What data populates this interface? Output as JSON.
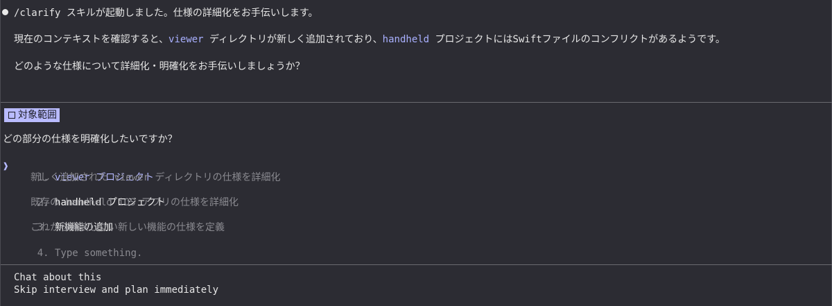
{
  "message": {
    "intro": "/clarify スキルが起動しました。仕様の詳細化をお手伝いします。",
    "context_pre": "現在のコンテキストを確認すると、",
    "context_viewer": "viewer",
    "context_mid": " ディレクトリが新しく追加されており、",
    "context_handheld": "handheld",
    "context_post": " プロジェクトにはSwiftファイルのコンフリクトがあるようです。",
    "question": "どのような仕様について詳細化・明確化をお手伝いしましょうか？"
  },
  "prompt": {
    "tag_label": "対象範囲",
    "question": "どの部分の仕様を明確化したいですか？",
    "cursor_glyph": "❱",
    "options": [
      {
        "number": "1.",
        "title": "viewer プロジェクト",
        "description": "新しく追加された viewer ディレクトリの仕様を詳細化",
        "selected": true
      },
      {
        "number": "2.",
        "title": "handheld プロジェクト",
        "description": "既存の handheld iOS アプリの仕様を詳細化",
        "selected": false
      },
      {
        "number": "3.",
        "title": "新機能の追加",
        "description": "これから実装したい新しい機能の仕様を定義",
        "selected": false
      },
      {
        "number": "4.",
        "title": "Type something.",
        "description": "",
        "selected": false
      }
    ]
  },
  "footer": {
    "chat_label": "Chat about this",
    "skip_label": "Skip interview and plan immediately"
  },
  "colors": {
    "background": "#2c2c33",
    "accent": "#b4b8ff",
    "tag_bg": "#b9bbff",
    "dim": "#8a8a90"
  }
}
